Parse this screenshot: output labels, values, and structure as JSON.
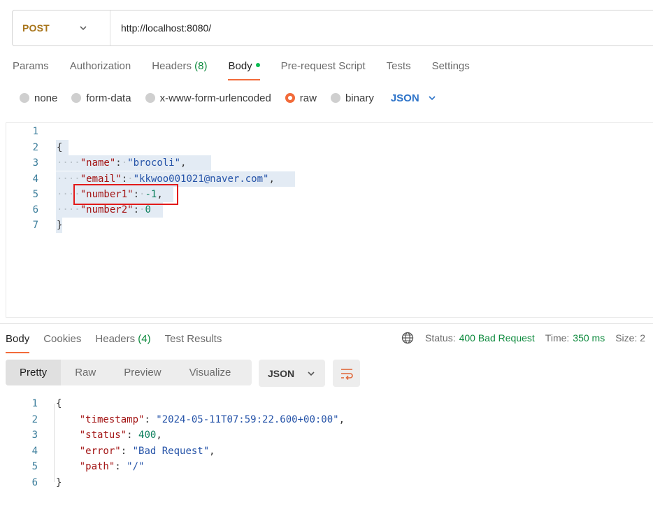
{
  "request": {
    "method": "POST",
    "url": "http://localhost:8080/"
  },
  "request_tabs": [
    {
      "label": "Params"
    },
    {
      "label": "Authorization"
    },
    {
      "label": "Headers",
      "count": "(8)"
    },
    {
      "label": "Body",
      "active": true
    },
    {
      "label": "Pre-request Script"
    },
    {
      "label": "Tests"
    },
    {
      "label": "Settings"
    }
  ],
  "body_types": {
    "none": "none",
    "form_data": "form-data",
    "urlencoded": "x-www-form-urlencoded",
    "raw": "raw",
    "binary": "binary",
    "format": "JSON",
    "selected": "raw"
  },
  "request_body": {
    "line_numbers": [
      "1",
      "2",
      "3",
      "4",
      "5",
      "6",
      "7"
    ],
    "open_brace": "{",
    "close_brace": "}",
    "fields": [
      {
        "key": "\"name\"",
        "value": "\"brocoli\"",
        "comma": ","
      },
      {
        "key": "\"email\"",
        "value": "\"kkwoo001021@naver.com\"",
        "comma": ","
      },
      {
        "key": "\"number1\"",
        "value": "-1",
        "comma": ","
      },
      {
        "key": "\"number2\"",
        "value": "0",
        "comma": ""
      }
    ]
  },
  "response_tabs": [
    {
      "label": "Body",
      "active": true
    },
    {
      "label": "Cookies"
    },
    {
      "label": "Headers",
      "count": "(4)"
    },
    {
      "label": "Test Results"
    }
  ],
  "response_status": {
    "status_label": "Status:",
    "status_value": "400 Bad Request",
    "time_label": "Time:",
    "time_value": "350 ms",
    "size_label": "Size: 2"
  },
  "view_modes": [
    "Pretty",
    "Raw",
    "Preview",
    "Visualize"
  ],
  "response_format": "JSON",
  "response_body": {
    "line_numbers": [
      "1",
      "2",
      "3",
      "4",
      "5",
      "6"
    ],
    "open_brace": "{",
    "close_brace": "}",
    "fields": [
      {
        "key": "\"timestamp\"",
        "value": "\"2024-05-11T07:59:22.600+00:00\"",
        "comma": ","
      },
      {
        "key": "\"status\"",
        "value": "400",
        "comma": ","
      },
      {
        "key": "\"error\"",
        "value": "\"Bad Request\"",
        "comma": ","
      },
      {
        "key": "\"path\"",
        "value": "\"/\"",
        "comma": ""
      }
    ]
  },
  "colors": {
    "method": "#a8751b",
    "accent": "#f26b3a",
    "success_text": "#0d8a3d",
    "json_blue": "#2e74c9",
    "highlight_box": "#e21a1a"
  }
}
